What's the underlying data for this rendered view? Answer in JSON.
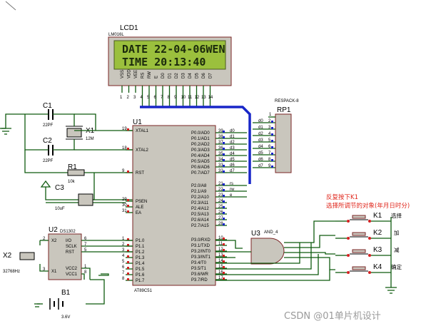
{
  "lcd": {
    "ref": "LCD1",
    "model": "LM016L",
    "line1": "DATE 22-04-06WEN",
    "line2": "TIME 20:13:40",
    "pins": [
      "VSS",
      "VDD",
      "VEE",
      "RS",
      "RW",
      "E",
      "D0",
      "D1",
      "D2",
      "D3",
      "D4",
      "D5",
      "D6",
      "D7"
    ]
  },
  "mcu": {
    "ref": "U1",
    "model": "AT89C51",
    "left_pins": [
      {
        "num": "19",
        "name": "XTAL1"
      },
      {
        "num": "18",
        "name": "XTAL2"
      },
      {
        "num": "9",
        "name": "RST"
      },
      {
        "num": "29",
        "name": "PSEN"
      },
      {
        "num": "30",
        "name": "ALE"
      },
      {
        "num": "31",
        "name": "EA"
      },
      {
        "num": "1",
        "name": "P1.0"
      },
      {
        "num": "2",
        "name": "P1.1"
      },
      {
        "num": "3",
        "name": "P1.2"
      },
      {
        "num": "4",
        "name": "P1.3"
      },
      {
        "num": "5",
        "name": "P1.4"
      },
      {
        "num": "6",
        "name": "P1.5"
      },
      {
        "num": "7",
        "name": "P1.6"
      },
      {
        "num": "8",
        "name": "P1.7"
      }
    ],
    "right_pins": [
      {
        "num": "39",
        "name": "P0.0/AD0",
        "net": "d0"
      },
      {
        "num": "38",
        "name": "P0.1/AD1",
        "net": "d1"
      },
      {
        "num": "37",
        "name": "P0.2/AD2",
        "net": "d2"
      },
      {
        "num": "36",
        "name": "P0.3/AD3",
        "net": "d3"
      },
      {
        "num": "35",
        "name": "P0.4/AD4",
        "net": "d4"
      },
      {
        "num": "34",
        "name": "P0.5/AD5",
        "net": "d5"
      },
      {
        "num": "33",
        "name": "P0.6/AD6",
        "net": "d6"
      },
      {
        "num": "32",
        "name": "P0.7/AD7",
        "net": "d7"
      },
      {
        "num": "21",
        "name": "P2.0/A8",
        "net": "rs"
      },
      {
        "num": "22",
        "name": "P2.1/A9",
        "net": "rw"
      },
      {
        "num": "23",
        "name": "P2.2/A10",
        "net": "e"
      },
      {
        "num": "24",
        "name": "P2.3/A11",
        "net": ""
      },
      {
        "num": "25",
        "name": "P2.4/A12",
        "net": ""
      },
      {
        "num": "26",
        "name": "P2.5/A13",
        "net": ""
      },
      {
        "num": "27",
        "name": "P2.6/A14",
        "net": ""
      },
      {
        "num": "28",
        "name": "P2.7/A15",
        "net": ""
      },
      {
        "num": "10",
        "name": "P3.0/RXD",
        "net": ""
      },
      {
        "num": "11",
        "name": "P3.1/TXD",
        "net": ""
      },
      {
        "num": "12",
        "name": "P3.2/INT0",
        "net": ""
      },
      {
        "num": "13",
        "name": "P3.3/INT1",
        "net": ""
      },
      {
        "num": "14",
        "name": "P3.4/T0",
        "net": ""
      },
      {
        "num": "15",
        "name": "P3.5/T1",
        "net": ""
      },
      {
        "num": "16",
        "name": "P3.6/WR",
        "net": ""
      },
      {
        "num": "17",
        "name": "P3.7/RD",
        "net": ""
      }
    ]
  },
  "rp1": {
    "ref": "RP1",
    "model": "RESPACK-8"
  },
  "c1": {
    "ref": "C1",
    "value": "22PF"
  },
  "c2": {
    "ref": "C2",
    "value": "22PF"
  },
  "x1": {
    "ref": "X1",
    "value": "12M"
  },
  "r1": {
    "ref": "R1",
    "value": "10k"
  },
  "c3": {
    "ref": "C3",
    "value": "10uF"
  },
  "u2": {
    "ref": "U2",
    "model": "DS1302",
    "left_pins": [
      {
        "num": "2",
        "name": "X2"
      },
      {
        "num": "3",
        "name": "X1"
      }
    ],
    "right_pins": [
      {
        "num": "6",
        "name": "I/O"
      },
      {
        "num": "7",
        "name": "SCLK"
      },
      {
        "num": "5",
        "name": "RST"
      },
      {
        "num": "1",
        "name": "VCC2"
      },
      {
        "num": "8",
        "name": "VCC1"
      }
    ]
  },
  "x2": {
    "ref": "X2",
    "value": "32768Hz"
  },
  "b1": {
    "ref": "B1",
    "value": "3.6V"
  },
  "u3": {
    "ref": "U3",
    "model": "AND_4"
  },
  "note": {
    "line1": "反复按下K1",
    "line2": "选择所调节的对象(年月日时分)"
  },
  "keys": [
    {
      "ref": "K1",
      "label": "选择"
    },
    {
      "ref": "K2",
      "label": "加"
    },
    {
      "ref": "K3",
      "label": "减"
    },
    {
      "ref": "K4",
      "label": "确定"
    }
  ],
  "watermark": "CSDN @01单片机设计",
  "colors": {
    "lcd_bg": "#9bc03d",
    "wire": "#0f5a0f",
    "bus": "#1826c8",
    "body": "#c9c6bd",
    "note": "#e0261b",
    "pin_blue": "#1826c8",
    "pin_red": "#d42020"
  }
}
